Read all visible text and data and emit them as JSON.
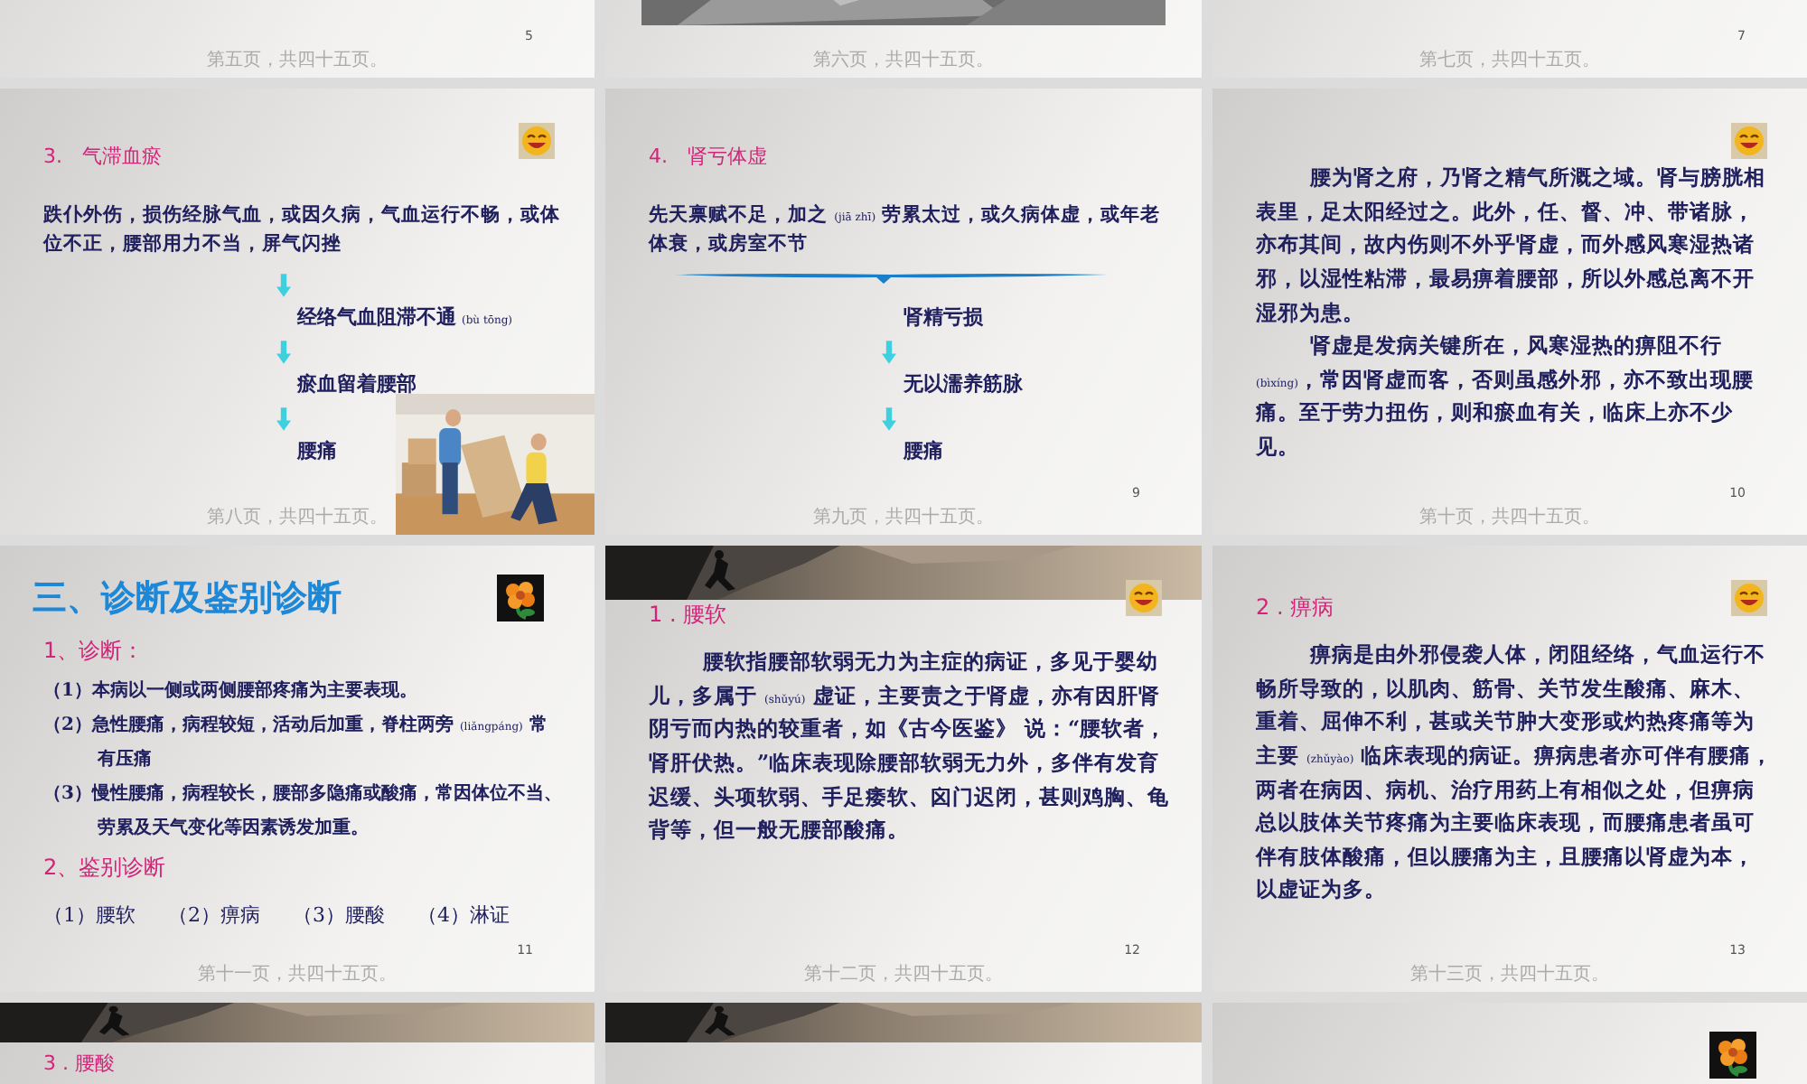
{
  "slides": [
    {
      "kind": "tail",
      "number": "5",
      "footer": "第五页，共四十五页。"
    },
    {
      "kind": "tail",
      "footer": "第六页，共四十五页。",
      "blocks": [
        {
          "kind": "picture"
        }
      ]
    },
    {
      "kind": "tail",
      "number": "7",
      "footer": "第七页，共四十五页。"
    },
    {
      "kind": "diagram",
      "footer": "第八页，共四十五页。",
      "blocks": [
        {
          "kind": "smiley"
        },
        {
          "kind": "heading",
          "text": "3.　气滞血瘀"
        },
        {
          "kind": "para",
          "text": "跌仆外伤，损伤经脉气血，或因久病，气血运行不畅，或体位不正，腰部用力不当，屏气闪挫"
        },
        {
          "kind": "arrow"
        },
        {
          "kind": "step",
          "text": "经络气血阻滞不通",
          "note": "(bù tōng)"
        },
        {
          "kind": "arrow"
        },
        {
          "kind": "step",
          "text": "瘀血留着腰部"
        },
        {
          "kind": "arrow"
        },
        {
          "kind": "step",
          "text": "腰痛"
        },
        {
          "kind": "picture"
        }
      ]
    },
    {
      "kind": "diagram",
      "number": "9",
      "footer": "第九页，共四十五页。",
      "blocks": [
        {
          "kind": "heading",
          "text": "4.　肾亏体虚"
        },
        {
          "kind": "para",
          "text": "先天禀赋不足，加之 $_{(jiā zhī)}$ 劳累太过，或久病体虚，或年老体衰，或房室不节"
        },
        {
          "kind": "brace"
        },
        {
          "kind": "step",
          "text": "肾精亏损"
        },
        {
          "kind": "arrow"
        },
        {
          "kind": "step",
          "text": "无以濡养筋脉"
        },
        {
          "kind": "arrow"
        },
        {
          "kind": "step",
          "text": "腰痛"
        }
      ]
    },
    {
      "kind": "text",
      "number": "10",
      "footer": "第十页，共四十五页。",
      "blocks": [
        {
          "kind": "smiley"
        },
        {
          "kind": "para",
          "indent": true,
          "text": "腰为肾之府，乃肾之精气所溉之域。肾与膀胱相表里，足太阳经过之。此外，任、督、冲、带诸脉，亦布其间，故内伤则不外乎肾虚，而外感风寒湿热诸邪，以湿性粘滞，最易痹着腰部，所以外感总离不开湿邪为患。"
        },
        {
          "kind": "para",
          "indent": true,
          "text": "**肾虚是发病关键**所在，风寒湿热的痹阻不行 $_{(bìxíng)}$，常因肾虚而客，否则虽感外邪，亦不致出现腰痛。至于劳力扭伤，则和瘀血有关，临床上亦不少见。"
        }
      ]
    },
    {
      "kind": "list",
      "number": "11",
      "footer": "第十一页，共四十五页。",
      "blocks": [
        {
          "kind": "flower"
        },
        {
          "kind": "title",
          "text": "三、诊断及鉴别诊断"
        },
        {
          "kind": "subheading",
          "text": "1、诊断："
        },
        {
          "kind": "item",
          "text": "（1）本病以一侧或两侧腰部疼痛为主要表现。"
        },
        {
          "kind": "item",
          "text": "（2）急性腰痛，病程较短，活动后加重，脊柱两旁 $_{(liǎngpáng)}$ 常有压痛"
        },
        {
          "kind": "item",
          "text": "（3）慢性腰痛，病程较长，腰部多隐痛或酸痛，常因体位不当、劳累及天气变化等因素诱发加重。"
        },
        {
          "kind": "subheading",
          "text": "2、鉴别诊断"
        },
        {
          "kind": "options",
          "items": [
            "（1）腰软",
            "（2）痹病",
            "（3）腰酸",
            "（4）淋证"
          ]
        }
      ]
    },
    {
      "kind": "text",
      "number": "12",
      "footer": "第十二页，共四十五页。",
      "blocks": [
        {
          "kind": "banner"
        },
        {
          "kind": "smiley"
        },
        {
          "kind": "heading",
          "text": "1 . 腰软"
        },
        {
          "kind": "para",
          "indent": true,
          "text": "腰软指腰部软弱无力为主症的病证，多见于婴幼儿，多属于 $_{(shǔyú)}$ 虚证，主要责之于肾虚，亦有因肝肾阴亏而内热的较重者，如《古今医鉴》 说：“腰软者，肾肝伏热。”临床表现除腰部软弱无力外，多伴有发育迟缓、头项软弱、手足痿软、囟门迟闭，甚则鸡胸、龟背等，但一般无腰部酸痛。"
        }
      ]
    },
    {
      "kind": "text",
      "number": "13",
      "footer": "第十三页，共四十五页。",
      "blocks": [
        {
          "kind": "smiley"
        },
        {
          "kind": "heading",
          "text": "2 . 痹病"
        },
        {
          "kind": "para",
          "indent": true,
          "text": "痹病是由外邪侵袭人体，闭阻经络，气血运行不畅所导致的，以肌肉、筋骨、关节发生酸痛、麻木、重着、屈伸不利，甚或关节肿大变形或灼热疼痛等为主要 $_{(zhǔyào)}$ 临床表现的病证。痹病患者亦可伴有腰痛，两者在病因、病机、治疗用药上有相似之处，但痹病总以肢体关节疼痛为主要临床表现，而腰痛患者虽可伴有肢体酸痛，但以腰痛为主，且腰痛以肾虚为本，以虚证为多。"
        }
      ]
    },
    {
      "kind": "head",
      "blocks": [
        {
          "kind": "banner"
        },
        {
          "kind": "heading",
          "text": "3 . 腰酸"
        }
      ]
    },
    {
      "kind": "head",
      "blocks": [
        {
          "kind": "banner"
        }
      ]
    },
    {
      "kind": "head",
      "blocks": [
        {
          "kind": "flower"
        }
      ]
    }
  ]
}
